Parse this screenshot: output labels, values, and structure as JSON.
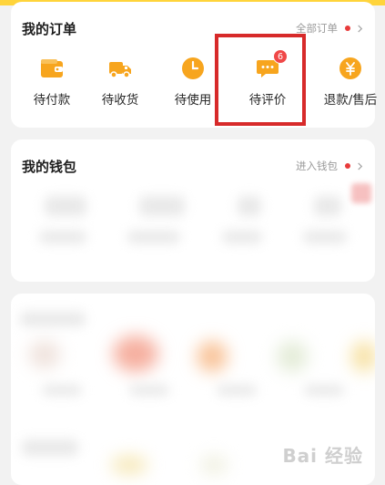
{
  "orders": {
    "title": "我的订单",
    "all_link": "全部订单",
    "items": [
      {
        "label": "待付款",
        "icon": "wallet-icon"
      },
      {
        "label": "待收货",
        "icon": "truck-icon"
      },
      {
        "label": "待使用",
        "icon": "clock-icon"
      },
      {
        "label": "待评价",
        "icon": "chat-bubble-icon",
        "badge": "6"
      },
      {
        "label": "退款/售后",
        "icon": "refund-yen-icon"
      }
    ]
  },
  "wallet": {
    "title": "我的钱包",
    "link": "进入钱包"
  },
  "watermark": "Bai 经验",
  "colors": {
    "accent": "#f7a51e",
    "highlight": "#d72a2a",
    "badge": "#f04848",
    "topbar": "#ffd43b"
  }
}
